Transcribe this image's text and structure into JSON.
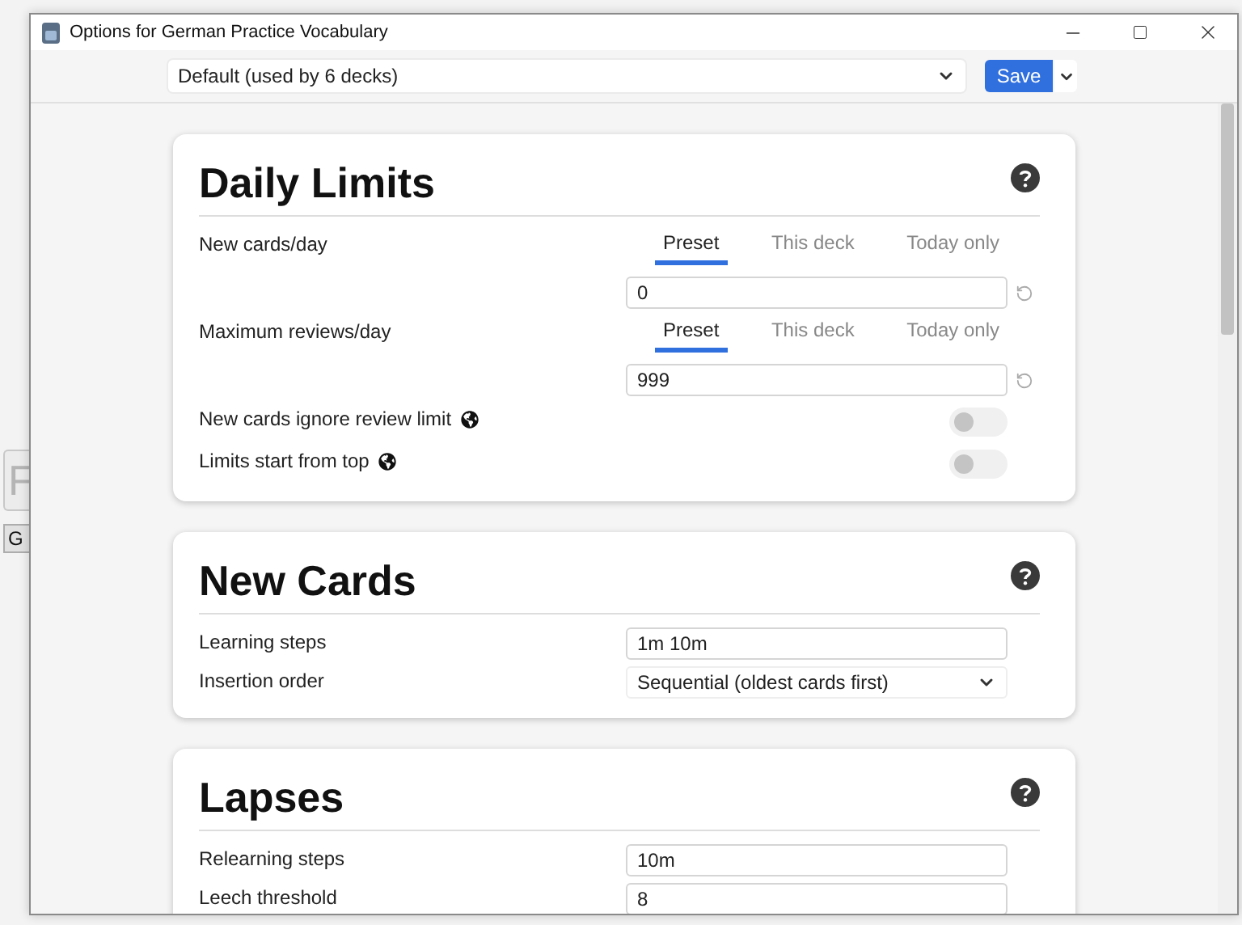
{
  "background": {
    "field_text": "F",
    "button": "G"
  },
  "window": {
    "title": "Options for German Practice Vocabulary"
  },
  "toolbar": {
    "preset": "Default (used by 6 decks)",
    "save": "Save"
  },
  "sections": [
    {
      "title": "Daily Limits",
      "rows": [
        {
          "kind": "tabbed",
          "label": "New cards/day",
          "tabs": [
            {
              "label": "Preset",
              "selected": true
            },
            {
              "label": "This deck",
              "selected": false
            },
            {
              "label": "Today only",
              "selected": false
            }
          ],
          "value": "0"
        },
        {
          "kind": "tabbed",
          "label": "Maximum reviews/day",
          "tabs": [
            {
              "label": "Preset",
              "selected": true
            },
            {
              "label": "This deck",
              "selected": false
            },
            {
              "label": "Today only",
              "selected": false
            }
          ],
          "value": "999"
        },
        {
          "kind": "toggle",
          "label": "New cards ignore review limit",
          "on": false
        },
        {
          "kind": "toggle",
          "label": "Limits start from top",
          "on": false
        }
      ]
    },
    {
      "title": "New Cards",
      "rows": [
        {
          "kind": "text",
          "label": "Learning steps",
          "value": "1m 10m"
        },
        {
          "kind": "select",
          "label": "Insertion order",
          "value": "Sequential (oldest cards first)"
        }
      ]
    },
    {
      "title": "Lapses",
      "rows": [
        {
          "kind": "text",
          "label": "Relearning steps",
          "value": "10m"
        },
        {
          "kind": "text",
          "label": "Leech threshold",
          "value": "8"
        }
      ]
    }
  ]
}
